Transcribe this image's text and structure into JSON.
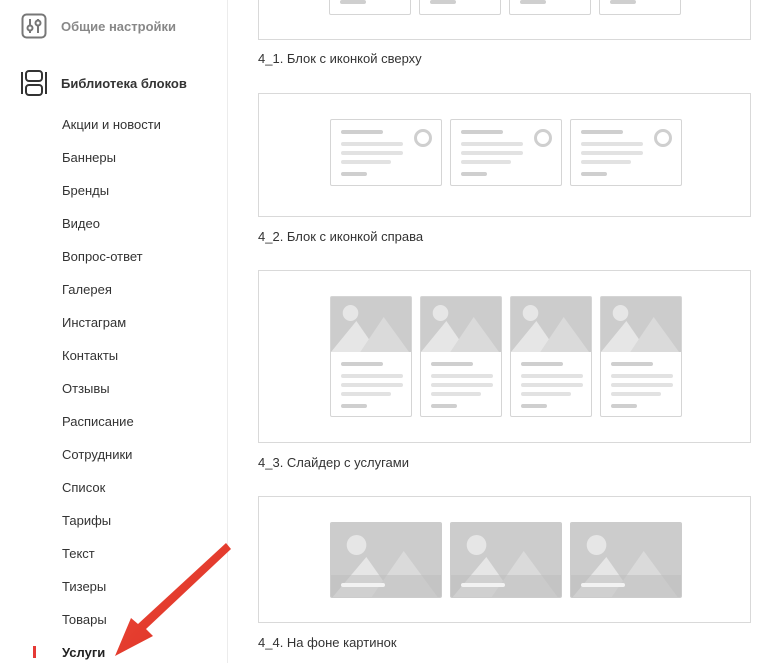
{
  "sidebar": {
    "general": {
      "label": "Общие настройки",
      "icon": "sliders-icon"
    },
    "library": {
      "label": "Библиотека блоков",
      "icon": "blocks-icon"
    },
    "items": [
      "Акции и новости",
      "Баннеры",
      "Бренды",
      "Видео",
      "Вопрос-ответ",
      "Галерея",
      "Инстаграм",
      "Контакты",
      "Отзывы",
      "Расписание",
      "Сотрудники",
      "Список",
      "Тарифы",
      "Текст",
      "Тизеры",
      "Товары",
      "Услуги"
    ],
    "active_item": "Услуги"
  },
  "blocks": [
    {
      "caption": "4_1. Блок с иконкой сверху"
    },
    {
      "caption": "4_2. Блок с иконкой справа"
    },
    {
      "caption": "4_3. Слайдер с услугами"
    },
    {
      "caption": "4_4. На фоне картинок"
    }
  ],
  "colors": {
    "accent": "#e53935",
    "placeholder_dark": "#cfcfcf",
    "placeholder_light": "#e2e2e2",
    "image_fill": "#cccccc"
  }
}
